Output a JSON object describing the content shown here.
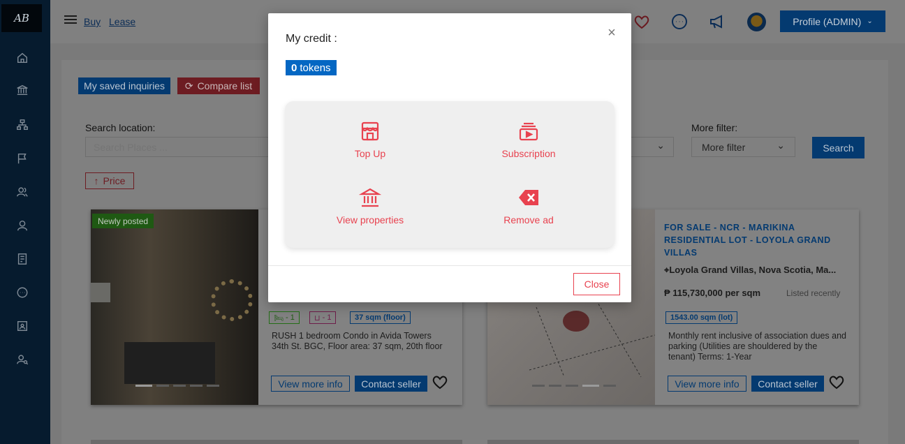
{
  "sidebar": {
    "logo": "AB",
    "items": [
      "home-icon",
      "bank-icon",
      "sitemap-icon",
      "flag-icon",
      "users-icon",
      "user-icon",
      "report-icon",
      "chat-icon",
      "id-card-icon",
      "user-search-icon"
    ]
  },
  "header": {
    "links": [
      "Buy",
      "Lease"
    ],
    "profile_label": "Profile (ADMIN)"
  },
  "toolbar": {
    "saved_label": "My saved inquiries",
    "compare_label": "Compare list"
  },
  "filters": {
    "search_label": "Search location:",
    "search_placeholder": "Search Places ...",
    "more_filter_label": "More filter:",
    "more_filter_value": "More filter",
    "search_button": "Search",
    "price_button": "Price"
  },
  "listings": [
    {
      "badge": "Newly posted",
      "beds": "- 1",
      "baths": "- 1",
      "area": "37 sqm (floor)",
      "description": "RUSH 1 bedroom Condo in Avida Towers 34th St. BGC, Floor area: 37 sqm, 20th floor",
      "view_label": "View more info",
      "contact_label": "Contact seller",
      "active_slide": 0
    },
    {
      "title": "FOR SALE - NCR - MARIKINA RESIDENTIAL LOT - LOYOLA GRAND VILLAS",
      "location": "Loyola Grand Villas, Nova Scotia, Ma...",
      "price": "₱ 115,730,000 per sqm",
      "listed": "Listed recently",
      "area": "1543.00 sqm (lot)",
      "description": "Monthly rent inclusive of association dues and parking (Utilities are shouldered by the tenant) Terms:  1-Year",
      "view_label": "View more info",
      "contact_label": "Contact seller",
      "active_slide": 3
    }
  ],
  "modal": {
    "title": "My credit :",
    "token_count": "0",
    "token_unit": "tokens",
    "items": [
      {
        "label": "Top Up",
        "icon": "store-icon"
      },
      {
        "label": "Subscription",
        "icon": "subscription-icon"
      },
      {
        "label": "View properties",
        "icon": "bank-icon"
      },
      {
        "label": "Remove ad",
        "icon": "backspace-icon"
      }
    ],
    "close_label": "Close",
    "accent": "#e8424f",
    "token_color": "#0467c3"
  }
}
